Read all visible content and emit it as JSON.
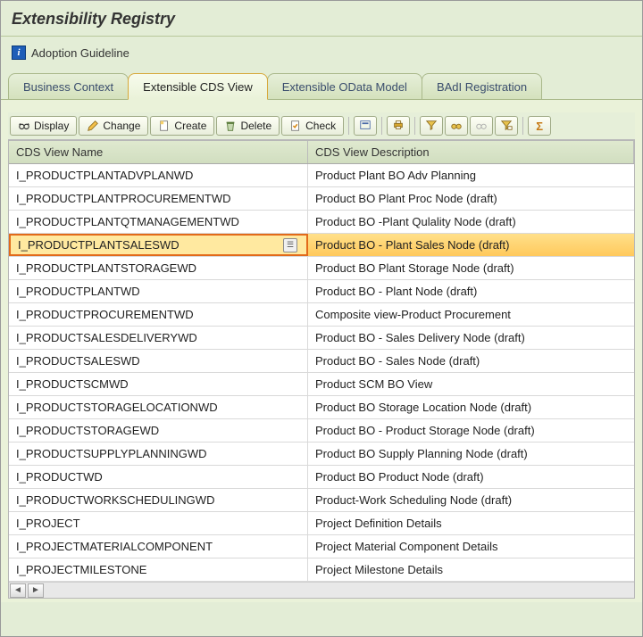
{
  "header": {
    "title": "Extensibility Registry"
  },
  "guideline": {
    "label": "Adoption Guideline"
  },
  "tabs": [
    {
      "label": "Business Context"
    },
    {
      "label": "Extensible CDS View"
    },
    {
      "label": "Extensible OData Model"
    },
    {
      "label": "BAdI Registration"
    }
  ],
  "toolbar": {
    "display": "Display",
    "change": "Change",
    "create": "Create",
    "delete": "Delete",
    "check": "Check"
  },
  "table": {
    "headers": {
      "name": "CDS View Name",
      "desc": "CDS View Description"
    },
    "rows": [
      {
        "name": "I_PRODUCTPLANTADVPLANWD",
        "desc": "Product Plant BO Adv Planning",
        "selected": false
      },
      {
        "name": "I_PRODUCTPLANTPROCUREMENTWD",
        "desc": "Product BO Plant Proc Node (draft)",
        "selected": false
      },
      {
        "name": "I_PRODUCTPLANTQTMANAGEMENTWD",
        "desc": "Product BO -Plant Qulality Node (draft)",
        "selected": false
      },
      {
        "name": "I_PRODUCTPLANTSALESWD",
        "desc": "Product BO - Plant Sales Node (draft)",
        "selected": true
      },
      {
        "name": "I_PRODUCTPLANTSTORAGEWD",
        "desc": "Product BO Plant Storage Node (draft)",
        "selected": false
      },
      {
        "name": "I_PRODUCTPLANTWD",
        "desc": "Product BO - Plant Node (draft)",
        "selected": false
      },
      {
        "name": "I_PRODUCTPROCUREMENTWD",
        "desc": "Composite view-Product Procurement",
        "selected": false
      },
      {
        "name": "I_PRODUCTSALESDELIVERYWD",
        "desc": "Product BO - Sales Delivery Node (draft)",
        "selected": false
      },
      {
        "name": "I_PRODUCTSALESWD",
        "desc": "Product BO - Sales Node (draft)",
        "selected": false
      },
      {
        "name": "I_PRODUCTSCMWD",
        "desc": "Product SCM BO View",
        "selected": false
      },
      {
        "name": "I_PRODUCTSTORAGELOCATIONWD",
        "desc": "Product BO Storage Location Node (draft)",
        "selected": false
      },
      {
        "name": "I_PRODUCTSTORAGEWD",
        "desc": "Product BO - Product Storage Node (draft)",
        "selected": false
      },
      {
        "name": "I_PRODUCTSUPPLYPLANNINGWD",
        "desc": "Product BO Supply Planning Node (draft)",
        "selected": false
      },
      {
        "name": "I_PRODUCTWD",
        "desc": "Product BO Product Node (draft)",
        "selected": false
      },
      {
        "name": "I_PRODUCTWORKSCHEDULINGWD",
        "desc": "Product-Work Scheduling Node (draft)",
        "selected": false
      },
      {
        "name": "I_PROJECT",
        "desc": "Project Definition Details",
        "selected": false
      },
      {
        "name": "I_PROJECTMATERIALCOMPONENT",
        "desc": "Project Material Component Details",
        "selected": false
      },
      {
        "name": "I_PROJECTMILESTONE",
        "desc": "Project Milestone Details",
        "selected": false
      }
    ]
  }
}
